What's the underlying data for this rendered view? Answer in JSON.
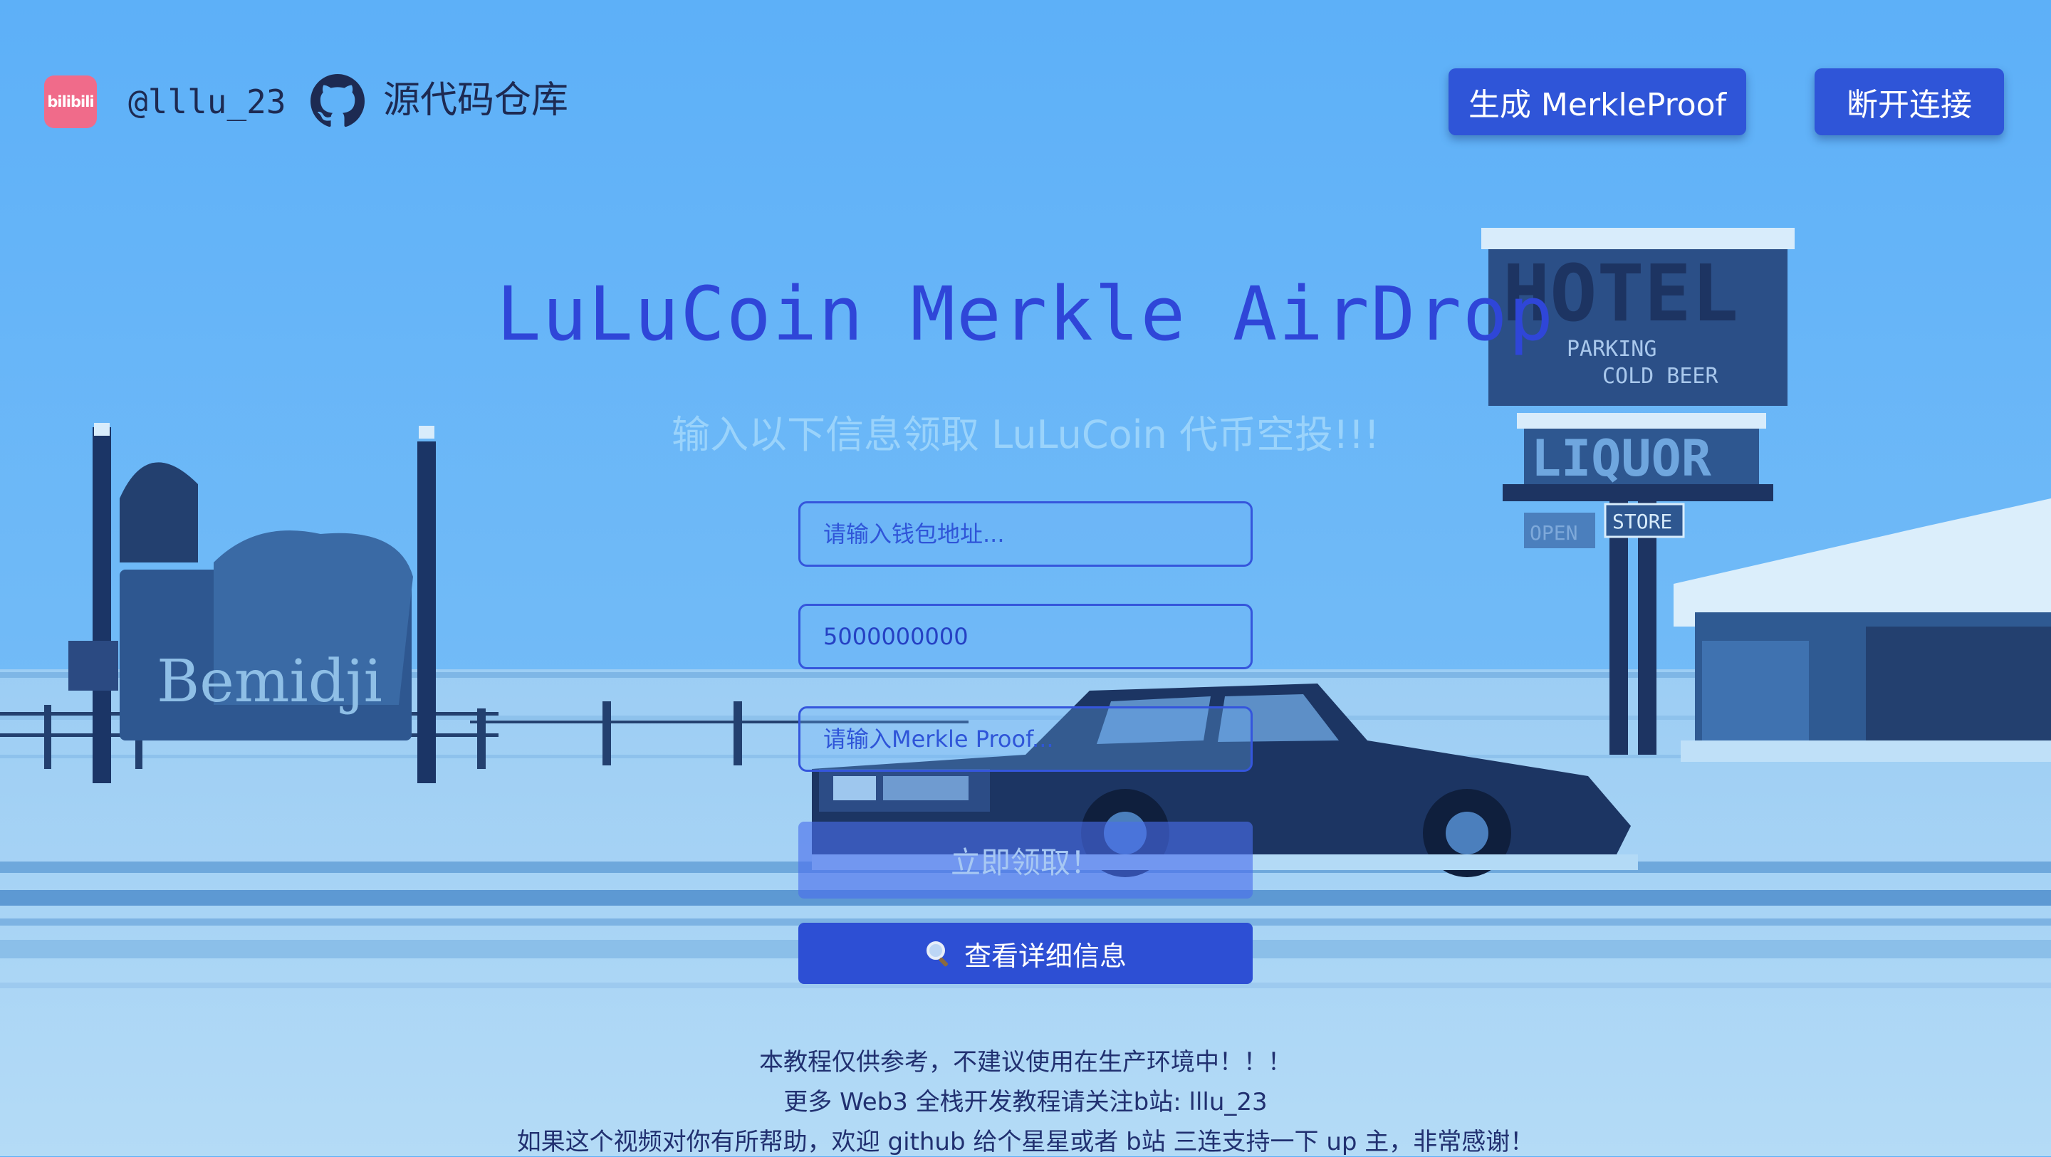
{
  "header": {
    "bilibili_logo": "bilibili",
    "handle": "@lllu_23",
    "repo_icon": "github-icon",
    "repo_label": "源代码仓库",
    "generate_button": "生成 MerkleProof",
    "disconnect_button": "断开连接"
  },
  "hero": {
    "title": "LuLuCoin Merkle AirDrop",
    "subtitle": "输入以下信息领取 LuLuCoin 代币空投!!!"
  },
  "form": {
    "wallet_placeholder": "请输入钱包地址...",
    "amount_value": "5000000000",
    "proof_placeholder": "请输入Merkle Proof...",
    "claim_button": "立即领取！",
    "details_button": "查看详细信息",
    "details_icon": "magnifier-icon"
  },
  "scene": {
    "sign_text": "Bemidji",
    "hotel_text": "HOTEL",
    "parking_text": "PARKING",
    "beer_text": "COLD BEER",
    "liquor_text": "LIQUOR",
    "open_text": "OPEN",
    "store_text": "STORE"
  },
  "footer": {
    "line1": "本教程仅供参考，不建议使用在生产环境中！！！",
    "line2": "更多 Web3 全栈开发教程请关注b站: lllu_23",
    "line3": "如果这个视频对你有所帮助，欢迎 github 给个星星或者 b站 三连支持一下 up 主，非常感谢！"
  },
  "colors": {
    "sky": "#5eb0f7",
    "snow": "#a9d4f5",
    "accent": "#2f55d8",
    "title": "#2f46d8",
    "text_dark": "#1d2a52"
  }
}
